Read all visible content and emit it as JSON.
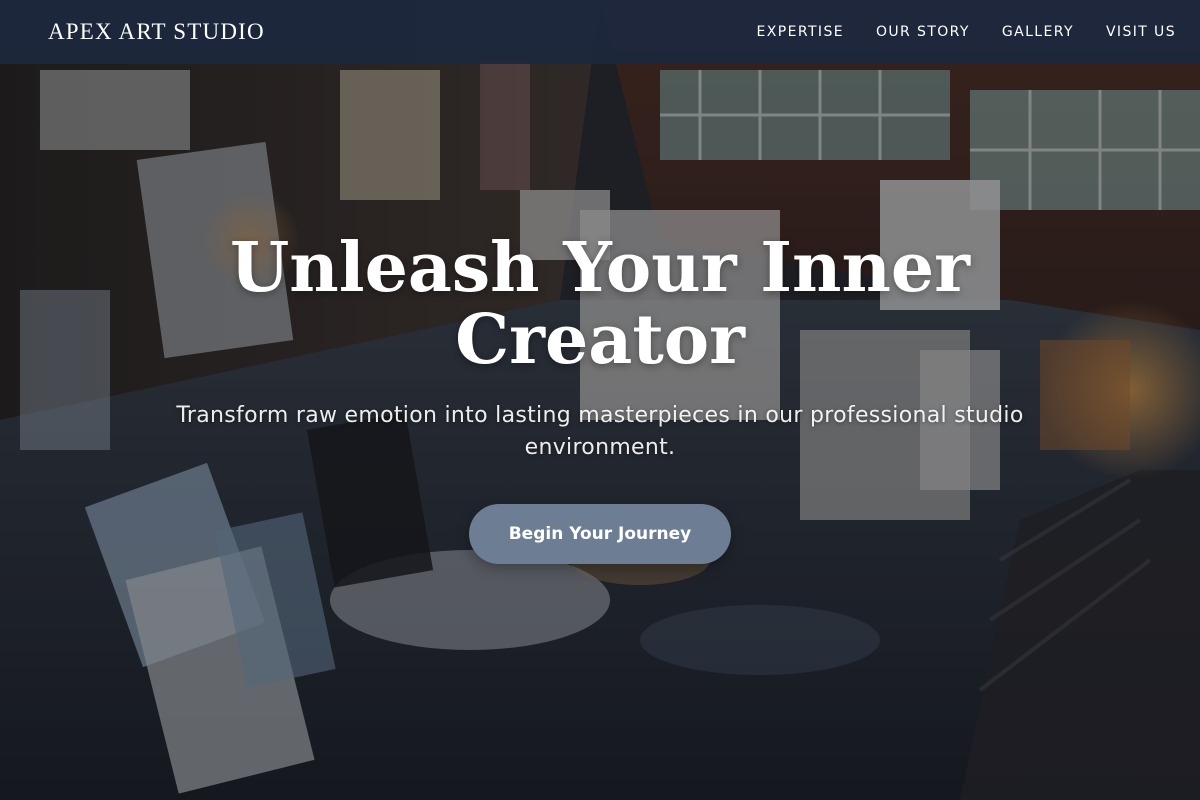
{
  "navbar": {
    "brand": "APEX ART STUDIO",
    "links": [
      {
        "label": "EXPERTISE"
      },
      {
        "label": "OUR STORY"
      },
      {
        "label": "GALLERY"
      },
      {
        "label": "VISIT US"
      }
    ]
  },
  "hero": {
    "background_image": "art studio interior with canvases",
    "title": "Unleash Your Inner Creator",
    "subtitle": "Transform raw emotion into lasting masterpieces in our professional studio environment.",
    "cta_label": "Begin Your Journey"
  },
  "colors": {
    "navbar_bg": "#1c283e",
    "cta_bg": "#6d7d94",
    "text": "#ffffff"
  }
}
